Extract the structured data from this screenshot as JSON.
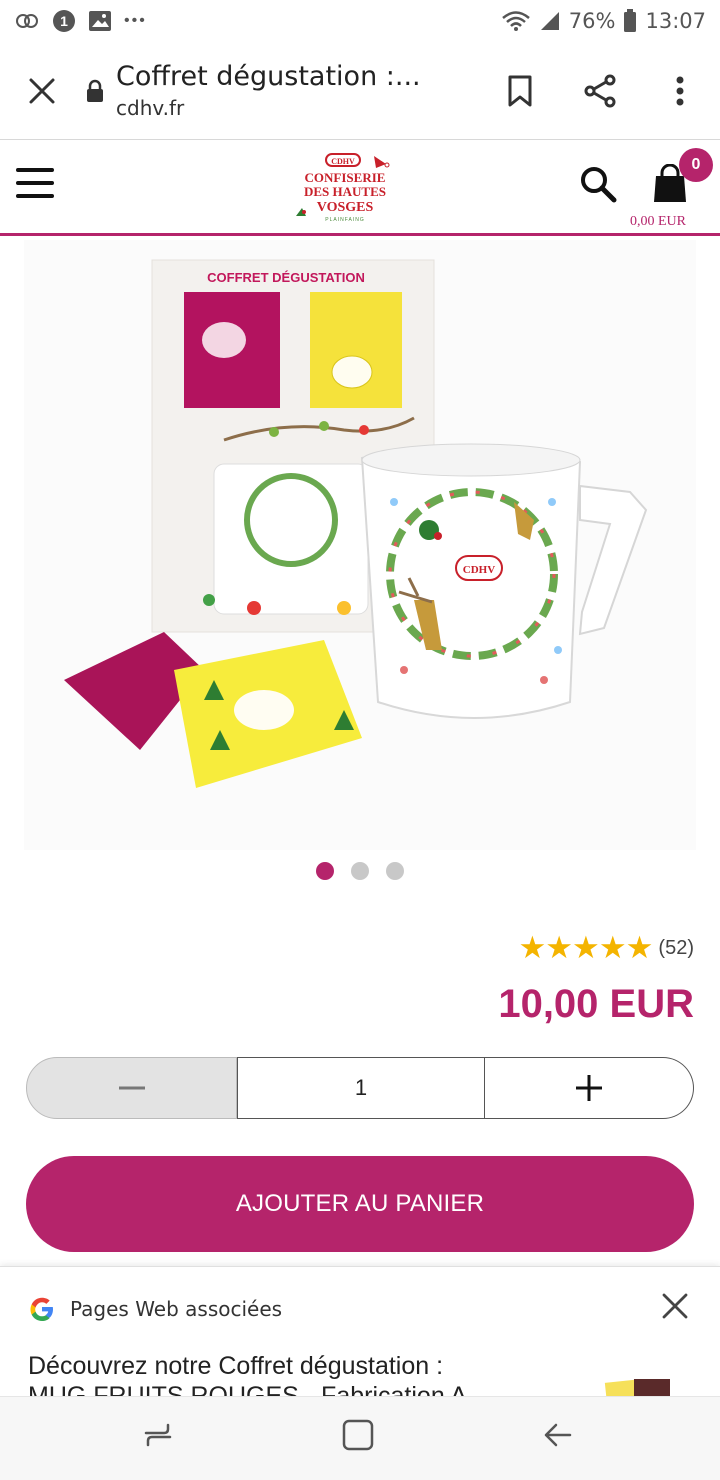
{
  "status_bar": {
    "battery": "76%",
    "time": "13:07",
    "more": "•••",
    "notification_badge": "1"
  },
  "browser": {
    "page_title": "Coffret dégustation :...",
    "url": "cdhv.fr"
  },
  "site": {
    "logo_text": [
      "CONFISERIE",
      "DES HAUTES",
      "VOSGES",
      "PLAINFAING"
    ],
    "logo_badge": "CDHV",
    "cart_count": "0",
    "cart_total": "0,00 EUR"
  },
  "product": {
    "box_label": "COFFRET DÉGUSTATION",
    "image_count": 3,
    "active_image": 1,
    "rating_stars": "★★★★★",
    "rating_count": "(52)",
    "price": "10,00 EUR",
    "quantity": "1",
    "add_to_cart_label": "AJOUTER AU PANIER"
  },
  "related_pages": {
    "title": "Pages Web associées",
    "snippet_line1": "Découvrez notre Coffret dégustation :",
    "snippet_line2": "MUG FRUITS ROUGES - Fabrication A..."
  },
  "colors": {
    "brand": "#b5246b",
    "star": "#f4b400",
    "mug_holly": "#c8202a"
  }
}
